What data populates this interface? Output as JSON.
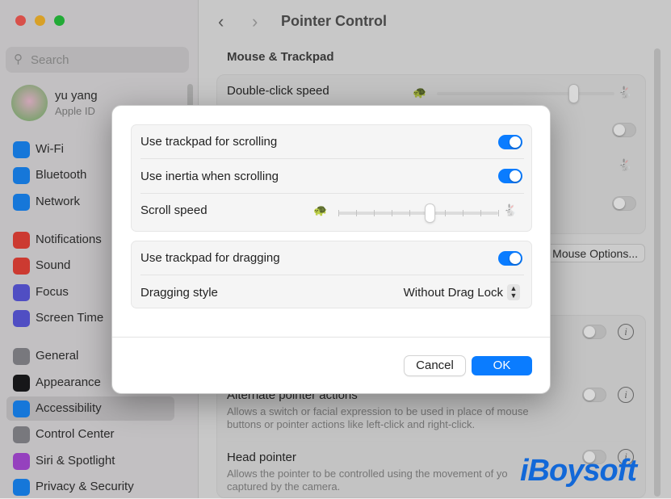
{
  "window": {
    "title": "Pointer Control"
  },
  "sidebar": {
    "search_placeholder": "Search",
    "user": {
      "name": "yu yang",
      "subtitle": "Apple ID"
    },
    "items": [
      {
        "label": "Wi-Fi",
        "icon": "wifi-icon",
        "color": "#1a8cff"
      },
      {
        "label": "Bluetooth",
        "icon": "bluetooth-icon",
        "color": "#1a8cff"
      },
      {
        "label": "Network",
        "icon": "globe-icon",
        "color": "#1a8cff"
      },
      {
        "label": "Notifications",
        "icon": "bell-icon",
        "color": "#f0453a"
      },
      {
        "label": "Sound",
        "icon": "speaker-icon",
        "color": "#f0453a"
      },
      {
        "label": "Focus",
        "icon": "moon-icon",
        "color": "#5e5ce6"
      },
      {
        "label": "Screen Time",
        "icon": "hourglass-icon",
        "color": "#5e5ce6"
      },
      {
        "label": "General",
        "icon": "gear-icon",
        "color": "#8e8e93"
      },
      {
        "label": "Appearance",
        "icon": "appearance-icon",
        "color": "#1c1c1e"
      },
      {
        "label": "Accessibility",
        "icon": "accessibility-icon",
        "color": "#1a8cff",
        "selected": true
      },
      {
        "label": "Control Center",
        "icon": "control-center-icon",
        "color": "#8e8e93"
      },
      {
        "label": "Siri & Spotlight",
        "icon": "siri-icon",
        "color": "#b04de0"
      },
      {
        "label": "Privacy & Security",
        "icon": "hand-icon",
        "color": "#1a8cff"
      }
    ]
  },
  "main": {
    "section": "Mouse & Trackpad",
    "double_click": "Double-click speed",
    "mouse_options": "Mouse Options...",
    "alternate": {
      "title": "Alternate pointer actions",
      "desc1": "Allows a switch or facial expression to be used in place of mouse",
      "desc2": "buttons or pointer actions like left-click and right-click.",
      "enabled": false
    },
    "head": {
      "title": "Head pointer",
      "desc1": "Allows the pointer to be controlled using the movement of yo",
      "desc2": "captured by the camera.",
      "enabled": false
    }
  },
  "dialog": {
    "scroll_trackpad": {
      "label": "Use trackpad for scrolling",
      "enabled": true
    },
    "inertia": {
      "label": "Use inertia when scrolling",
      "enabled": true
    },
    "scroll_speed": {
      "label": "Scroll speed",
      "value_fraction": 0.57,
      "ticks": 10
    },
    "drag_trackpad": {
      "label": "Use trackpad for dragging",
      "enabled": true
    },
    "drag_style": {
      "label": "Dragging style",
      "value": "Without Drag Lock"
    },
    "cancel": "Cancel",
    "ok": "OK",
    "accent": "#0a7cff"
  },
  "watermark": "iBoysoft"
}
